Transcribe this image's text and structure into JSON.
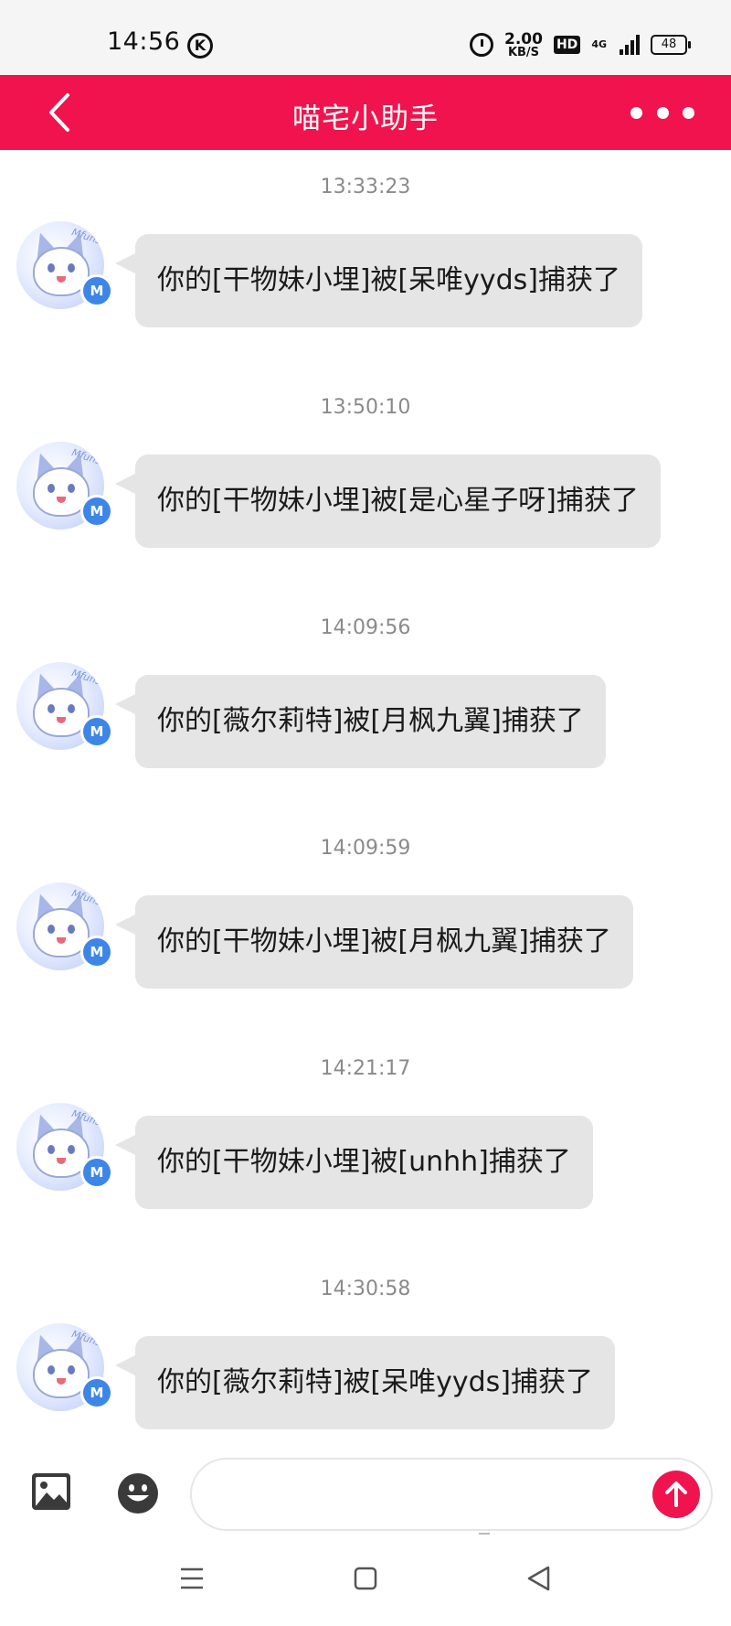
{
  "status_bar": {
    "time": "14:56",
    "speed_value": "2.00",
    "speed_unit": "KB/S",
    "hd_label": "HD",
    "network": "4G",
    "battery": "48"
  },
  "header": {
    "title": "喵宅小助手"
  },
  "messages": [
    {
      "time": "13:33:23",
      "text": "你的[干物妹小埋]被[呆唯yyds]捕获了"
    },
    {
      "time": "13:50:10",
      "text": "你的[干物妹小埋]被[是心星子呀]捕获了"
    },
    {
      "time": "14:09:56",
      "text": "你的[薇尔莉特]被[月枫九翼]捕获了"
    },
    {
      "time": "14:09:59",
      "text": "你的[干物妹小埋]被[月枫九翼]捕获了"
    },
    {
      "time": "14:21:17",
      "text": "你的[干物妹小埋]被[unhh]捕获了"
    },
    {
      "time": "14:30:58",
      "text": "你的[薇尔莉特]被[呆唯yyds]捕获了"
    }
  ],
  "avatar": {
    "badge": "M",
    "tag": "Mfuns"
  },
  "input": {
    "placeholder": "",
    "value": ""
  },
  "colors": {
    "accent": "#f0134d",
    "bubble": "#e5e5e5",
    "badge": "#3d86e8"
  },
  "icons": {
    "back": "chevron-left-icon",
    "more": "more-dots-icon",
    "image": "image-icon",
    "emoji": "emoji-icon",
    "send": "arrow-up-icon"
  }
}
